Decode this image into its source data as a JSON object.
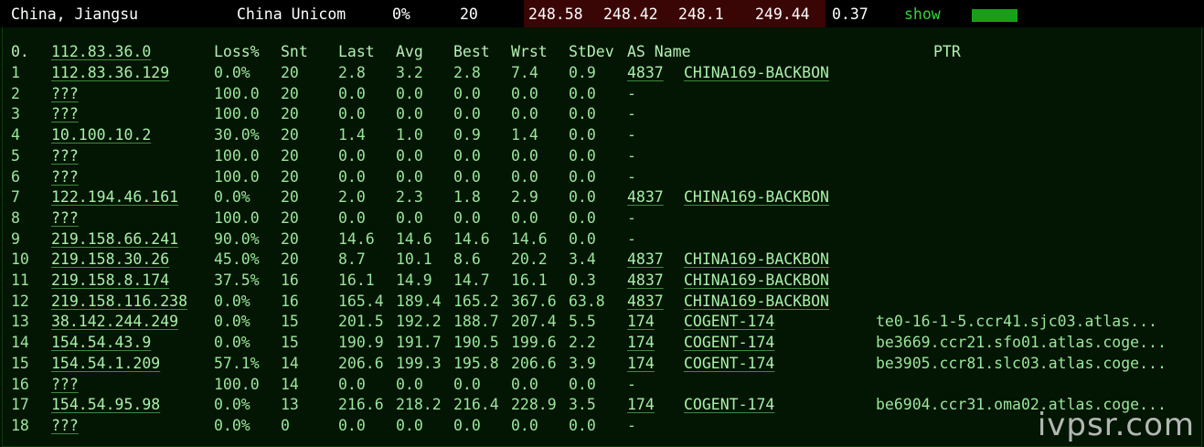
{
  "summary": {
    "location": "China, Jiangsu",
    "isp": "China Unicom",
    "loss": "0%",
    "sent": "20",
    "last": "248.58",
    "avg": "248.42",
    "best": "248.1",
    "worst": "249.44",
    "stdev": "0.37",
    "show_label": "show",
    "colors": {
      "latency_bg": "#3a0505",
      "show_bar": "#1a9e1a"
    }
  },
  "headers": [
    "0.",
    "112.83.36.0",
    "Loss%",
    "Snt",
    "Last",
    "Avg",
    "Best",
    "Wrst",
    "StDev",
    "AS Name",
    "PTR"
  ],
  "hops": [
    {
      "n": "1",
      "ip": "112.83.36.129",
      "loss": "0.0%",
      "snt": "20",
      "last": "2.8",
      "avg": "3.2",
      "best": "2.8",
      "wrst": "7.4",
      "stdev": "0.9",
      "asn": "4837",
      "as_name": "CHINA169-BACKBON",
      "ptr": ""
    },
    {
      "n": "2",
      "ip": "???",
      "loss": "100.0",
      "snt": "20",
      "last": "0.0",
      "avg": "0.0",
      "best": "0.0",
      "wrst": "0.0",
      "stdev": "0.0",
      "asn": "-",
      "as_name": "",
      "ptr": ""
    },
    {
      "n": "3",
      "ip": "???",
      "loss": "100.0",
      "snt": "20",
      "last": "0.0",
      "avg": "0.0",
      "best": "0.0",
      "wrst": "0.0",
      "stdev": "0.0",
      "asn": "-",
      "as_name": "",
      "ptr": ""
    },
    {
      "n": "4",
      "ip": "10.100.10.2",
      "loss": "30.0%",
      "snt": "20",
      "last": "1.4",
      "avg": "1.0",
      "best": "0.9",
      "wrst": "1.4",
      "stdev": "0.0",
      "asn": "-",
      "as_name": "",
      "ptr": ""
    },
    {
      "n": "5",
      "ip": "???",
      "loss": "100.0",
      "snt": "20",
      "last": "0.0",
      "avg": "0.0",
      "best": "0.0",
      "wrst": "0.0",
      "stdev": "0.0",
      "asn": "-",
      "as_name": "",
      "ptr": ""
    },
    {
      "n": "6",
      "ip": "???",
      "loss": "100.0",
      "snt": "20",
      "last": "0.0",
      "avg": "0.0",
      "best": "0.0",
      "wrst": "0.0",
      "stdev": "0.0",
      "asn": "-",
      "as_name": "",
      "ptr": ""
    },
    {
      "n": "7",
      "ip": "122.194.46.161",
      "loss": "0.0%",
      "snt": "20",
      "last": "2.0",
      "avg": "2.3",
      "best": "1.8",
      "wrst": "2.9",
      "stdev": "0.0",
      "asn": "4837",
      "as_name": "CHINA169-BACKBON",
      "ptr": ""
    },
    {
      "n": "8",
      "ip": "???",
      "loss": "100.0",
      "snt": "20",
      "last": "0.0",
      "avg": "0.0",
      "best": "0.0",
      "wrst": "0.0",
      "stdev": "0.0",
      "asn": "-",
      "as_name": "",
      "ptr": ""
    },
    {
      "n": "9",
      "ip": "219.158.66.241",
      "loss": "90.0%",
      "snt": "20",
      "last": "14.6",
      "avg": "14.6",
      "best": "14.6",
      "wrst": "14.6",
      "stdev": "0.0",
      "asn": "-",
      "as_name": "",
      "ptr": ""
    },
    {
      "n": "10",
      "ip": "219.158.30.26",
      "loss": "45.0%",
      "snt": "20",
      "last": "8.7",
      "avg": "10.1",
      "best": "8.6",
      "wrst": "20.2",
      "stdev": "3.4",
      "asn": "4837",
      "as_name": "CHINA169-BACKBON",
      "ptr": ""
    },
    {
      "n": "11",
      "ip": "219.158.8.174",
      "loss": "37.5%",
      "snt": "16",
      "last": "16.1",
      "avg": "14.9",
      "best": "14.7",
      "wrst": "16.1",
      "stdev": "0.3",
      "asn": "4837",
      "as_name": "CHINA169-BACKBON",
      "ptr": ""
    },
    {
      "n": "12",
      "ip": "219.158.116.238",
      "loss": "0.0%",
      "snt": "16",
      "last": "165.4",
      "avg": "189.4",
      "best": "165.2",
      "wrst": "367.6",
      "stdev": "63.8",
      "asn": "4837",
      "as_name": "CHINA169-BACKBON",
      "ptr": ""
    },
    {
      "n": "13",
      "ip": "38.142.244.249",
      "loss": "0.0%",
      "snt": "15",
      "last": "201.5",
      "avg": "192.2",
      "best": "188.7",
      "wrst": "207.4",
      "stdev": "5.5",
      "asn": "174",
      "as_name": "COGENT-174",
      "ptr": "te0-16-1-5.ccr41.sjc03.atlas..."
    },
    {
      "n": "14",
      "ip": "154.54.43.9",
      "loss": "0.0%",
      "snt": "15",
      "last": "190.9",
      "avg": "191.7",
      "best": "190.5",
      "wrst": "199.6",
      "stdev": "2.2",
      "asn": "174",
      "as_name": "COGENT-174",
      "ptr": "be3669.ccr21.sfo01.atlas.coge..."
    },
    {
      "n": "15",
      "ip": "154.54.1.209",
      "loss": "57.1%",
      "snt": "14",
      "last": "206.6",
      "avg": "199.3",
      "best": "195.8",
      "wrst": "206.6",
      "stdev": "3.9",
      "asn": "174",
      "as_name": "COGENT-174",
      "ptr": "be3905.ccr81.slc03.atlas.coge..."
    },
    {
      "n": "16",
      "ip": "???",
      "loss": "100.0",
      "snt": "14",
      "last": "0.0",
      "avg": "0.0",
      "best": "0.0",
      "wrst": "0.0",
      "stdev": "0.0",
      "asn": "-",
      "as_name": "",
      "ptr": ""
    },
    {
      "n": "17",
      "ip": "154.54.95.98",
      "loss": "0.0%",
      "snt": "13",
      "last": "216.6",
      "avg": "218.2",
      "best": "216.4",
      "wrst": "228.9",
      "stdev": "3.5",
      "asn": "174",
      "as_name": "COGENT-174",
      "ptr": "be6904.ccr31.oma02.atlas.coge..."
    },
    {
      "n": "18",
      "ip": "???",
      "loss": "0.0%",
      "snt": "0",
      "last": "0.0",
      "avg": "0.0",
      "best": "0.0",
      "wrst": "0.0",
      "stdev": "0.0",
      "asn": "-",
      "as_name": "",
      "ptr": ""
    }
  ],
  "watermark": "ivpsr.com"
}
